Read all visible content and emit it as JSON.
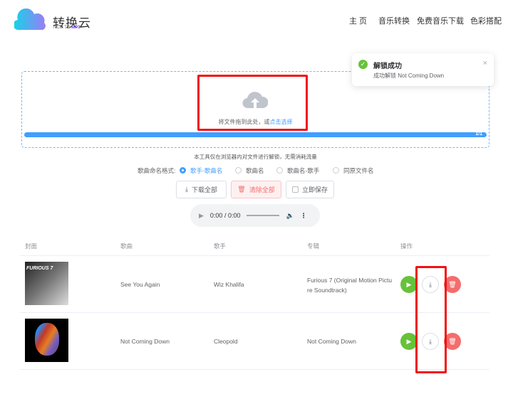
{
  "header": {
    "logo_title": "转换云",
    "logo_sub_prefix": "NCM TO ",
    "logo_sub_accent": "MP3",
    "nav": [
      "主 页",
      "音乐转换",
      "免费音乐下载",
      "色彩搭配"
    ]
  },
  "toast": {
    "title": "解锁成功",
    "message": "成功解锁 Not Coming Down",
    "icon": "check-circle-icon"
  },
  "upload": {
    "text": "将文件拖到此处，或",
    "link": "点击选择",
    "progress_label": "1/1",
    "progress_percent": 100
  },
  "note": "本工具仅在浏览器内对文件进行解锁，无需消耗流量",
  "naming": {
    "label": "歌曲命名格式:",
    "options": [
      "歌手-歌曲名",
      "歌曲名",
      "歌曲名-歌手",
      "同原文件名"
    ],
    "selected": 0
  },
  "buttons": {
    "download_all": "下载全部",
    "clear_all": "清除全部",
    "save_now": "立即保存"
  },
  "audio": {
    "time": "0:00 / 0:00"
  },
  "table": {
    "headers": [
      "封面",
      "歌曲",
      "歌手",
      "专辑",
      "操作"
    ],
    "rows": [
      {
        "song": "See You Again",
        "artist": "Wiz Khalifa",
        "album": "Furious 7 (Original Motion Picture Soundtrack)",
        "cover_text": "FURIOUS 7"
      },
      {
        "song": "Not Coming Down",
        "artist": "Cleopold",
        "album": "Not Coming Down"
      }
    ]
  }
}
